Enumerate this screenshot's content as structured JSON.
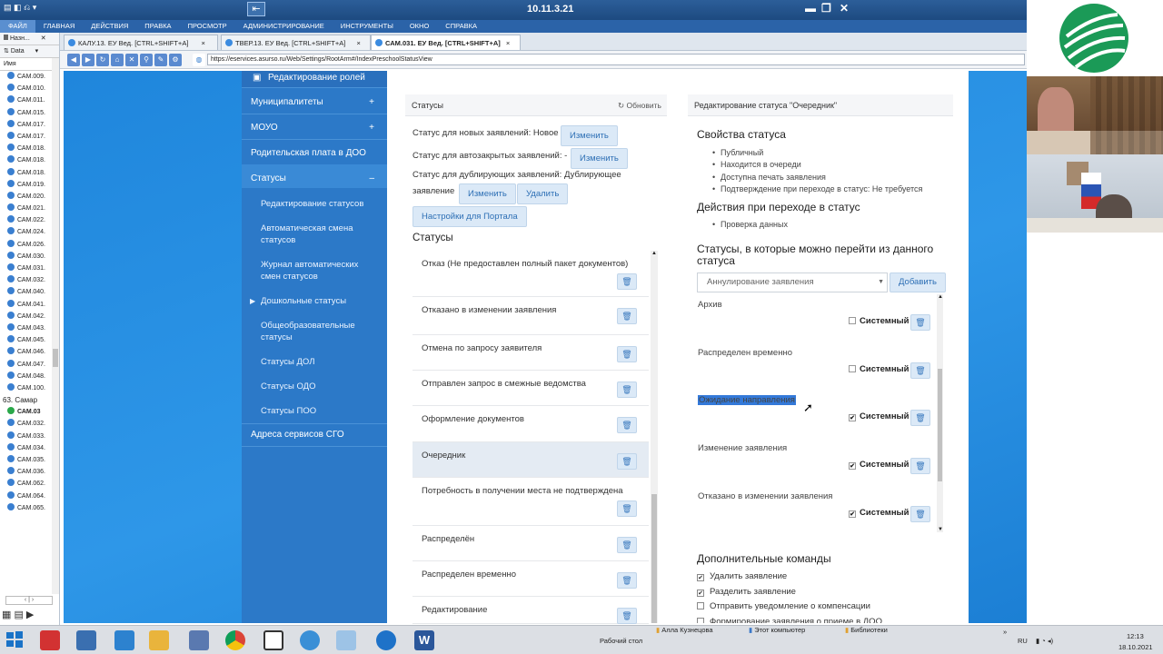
{
  "rdp": {
    "host": "10.11.3.21"
  },
  "menu": [
    "ФАЙЛ",
    "ГЛАВНАЯ",
    "ДЕЙСТВИЯ",
    "ПРАВКА",
    "ПРОСМОТР",
    "АДМИНИСТРИРОВАНИЕ",
    "ИНСТРУМЕНТЫ",
    "ОКНО",
    "СПРАВКА"
  ],
  "tabs": [
    "КАЛУ.13. ЕУ Вед. [CTRL+SHIFT+A]",
    "ТВЕР.13. ЕУ Вед. [CTRL+SHIFT+A]",
    "САМ.031. ЕУ Вед. [CTRL+SHIFT+A]"
  ],
  "tree": {
    "top_label": "Назн...",
    "data_label": "Data",
    "col_header": "Имя",
    "items_a": [
      "САМ.009.",
      "САМ.010.",
      "САМ.011.",
      "САМ.015.",
      "САМ.017.",
      "САМ.017.",
      "САМ.018.",
      "САМ.018.",
      "САМ.018.",
      "САМ.019.",
      "САМ.020.",
      "САМ.021.",
      "САМ.022.",
      "САМ.024.",
      "САМ.026.",
      "САМ.030.",
      "САМ.031.",
      "САМ.032.",
      "САМ.040.",
      "САМ.041.",
      "САМ.042.",
      "САМ.043.",
      "САМ.045.",
      "САМ.046.",
      "САМ.047.",
      "САМ.048.",
      "САМ.100."
    ],
    "group": "63. Самар",
    "items_b": [
      "САМ.03",
      "САМ.032.",
      "САМ.033.",
      "САМ.034.",
      "САМ.035.",
      "САМ.036.",
      "САМ.062.",
      "САМ.064.",
      "САМ.065."
    ]
  },
  "url": "https://eservices.asurso.ru/Web/Settings/RootArm#/IndexPreschoolStatusView",
  "sidenav": {
    "top": "Редактирование ролей",
    "items": [
      "Муниципалитеты",
      "МОУО",
      "Родительская плата в ДОО",
      "Статусы"
    ],
    "subs": [
      "Редактирование статусов",
      "Автоматическая смена статусов",
      "Журнал автоматических смен статусов",
      "Дошкольные статусы",
      "Общеобразовательные статусы",
      "Статусы ДОЛ",
      "Статусы ОДО",
      "Статусы ПОО"
    ],
    "bottom": "Адреса сервисов СГО"
  },
  "statuses_panel": {
    "title": "Статусы",
    "refresh": "Обновить",
    "new_label": "Статус для новых заявлений: Новое",
    "auto_label": "Статус для автозакрытых заявлений: -",
    "dup_label_1": "Статус для дублирующих заявлений: Дублирующее",
    "dup_label_2": "заявление",
    "change": "Изменить",
    "delete": "Удалить",
    "portal_btn": "Настройки для Портала",
    "list_title": "Статусы",
    "list": [
      "Отказ (Не предоставлен полный пакет документов)",
      "Отказано в изменении заявления",
      "Отмена по запросу заявителя",
      "Отправлен запрос в смежные ведомства",
      "Оформление документов",
      "Очередник",
      "Потребность в получении места не подтверждена",
      "Распределён",
      "Распределен временно",
      "Редактирование"
    ]
  },
  "edit_panel": {
    "title": "Редактирование статуса \"Очередник\"",
    "props_title": "Свойства статуса",
    "props": [
      "Публичный",
      "Находится в очереди",
      "Доступна печать заявления",
      "Подтверждение при переходе в статус: Не требуется"
    ],
    "actions_title": "Действия при переходе в статус",
    "actions": [
      "Проверка данных"
    ],
    "transitions_title": "Статусы, в которые можно перейти из данного статуса",
    "select_value": "Аннулирование заявления",
    "add": "Добавить",
    "system_label": "Системный",
    "transitions": [
      {
        "label": "Архив",
        "system": false
      },
      {
        "label": "Распределен временно",
        "system": false
      },
      {
        "label": "Ожидание направления",
        "system": true
      },
      {
        "label": "Изменение заявления",
        "system": true
      },
      {
        "label": "Отказано в изменении заявления",
        "system": true
      }
    ],
    "extra_title": "Дополнительные команды",
    "extra": [
      {
        "label": "Удалить заявление",
        "checked": true
      },
      {
        "label": "Разделить заявление",
        "checked": true
      },
      {
        "label": "Отправить уведомление о компенсации",
        "checked": false
      },
      {
        "label": "Формирование заявления о приеме в ДОО",
        "checked": false
      }
    ]
  },
  "taskbar": {
    "desktop": "Рабочий стол",
    "user": "Алла Кузнецова",
    "computer": "Этот компьютер",
    "libs": "Библиотеки",
    "lang": "RU",
    "time": "12:13",
    "date": "18.10.2021"
  }
}
